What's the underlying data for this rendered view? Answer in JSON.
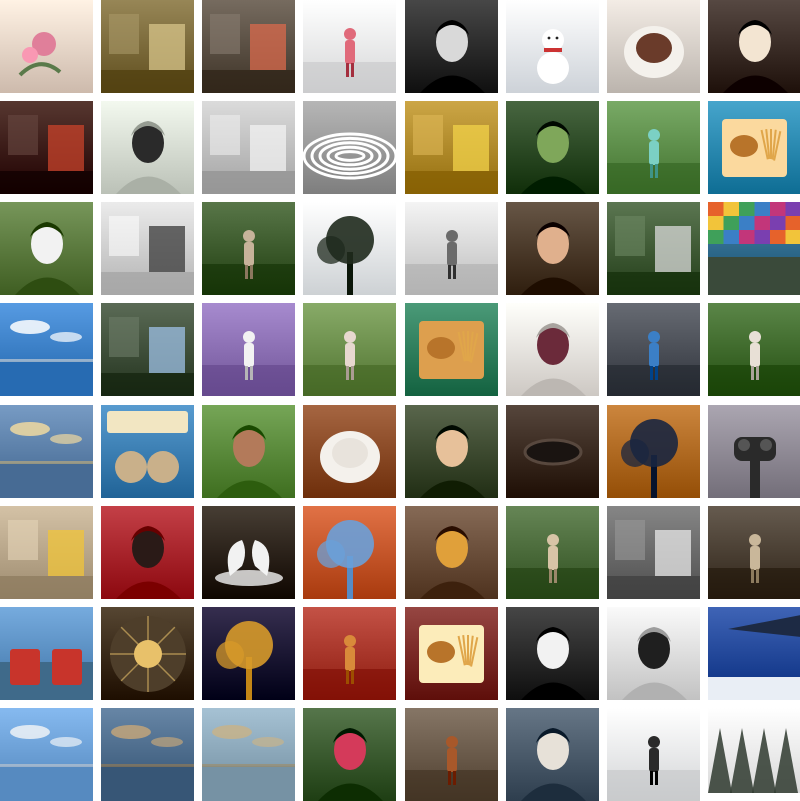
{
  "gallery": {
    "tiles": [
      {
        "icon": "pink-roses-photo",
        "bg": "#e9d6c8",
        "accent": "#e07f9a",
        "motif": "flower"
      },
      {
        "icon": "popcorn-stand-photo",
        "bg": "#7b6a3a",
        "accent": "#d7c48a",
        "motif": "scene"
      },
      {
        "icon": "cafe-counter-photo",
        "bg": "#5a4f43",
        "accent": "#d96a4c",
        "motif": "scene"
      },
      {
        "icon": "girl-in-snow-photo",
        "bg": "#f1f2f3",
        "accent": "#e06a7a",
        "motif": "figure"
      },
      {
        "icon": "smiling-woman-bw-photo",
        "bg": "#2b2b2b",
        "accent": "#d9d9d9",
        "motif": "portrait"
      },
      {
        "icon": "snowman-photo",
        "bg": "#e9eef4",
        "accent": "#ffffff",
        "motif": "snowman"
      },
      {
        "icon": "cocoa-cup-photo",
        "bg": "#d7d0c9",
        "accent": "#6a3b2a",
        "motif": "cup"
      },
      {
        "icon": "masked-face-photo",
        "bg": "#3a2c26",
        "accent": "#f3e5d2",
        "motif": "portrait"
      },
      {
        "icon": "theater-interior-photo",
        "bg": "#3b1b14",
        "accent": "#c8432b",
        "motif": "scene"
      },
      {
        "icon": "man-drinking-photo",
        "bg": "#d7ddd3",
        "accent": "#2a2a2a",
        "motif": "portrait"
      },
      {
        "icon": "man-in-bed-bw-photo",
        "bg": "#bfbfbf",
        "accent": "#f2f2f2",
        "motif": "scene"
      },
      {
        "icon": "guggenheim-rotunda-photo",
        "bg": "#9a9a9a",
        "accent": "#ffffff",
        "motif": "rings"
      },
      {
        "icon": "taxi-raindrops-photo",
        "bg": "#b08a2a",
        "accent": "#f2d14a",
        "motif": "scene"
      },
      {
        "icon": "woman-in-leaves-photo",
        "bg": "#2c4a25",
        "accent": "#7fa75a",
        "motif": "portrait"
      },
      {
        "icon": "man-with-bike-photo",
        "bg": "#5d8e4a",
        "accent": "#7bd0c4",
        "motif": "figure"
      },
      {
        "icon": "sandwich-and-fries-photo",
        "bg": "#2a89b0",
        "accent": "#e7c58a",
        "motif": "food"
      },
      {
        "icon": "man-sunglasses-photo",
        "bg": "#5b7a3e",
        "accent": "#f2f2f2",
        "motif": "portrait"
      },
      {
        "icon": "loft-interior-bw-photo",
        "bg": "#cfcfcf",
        "accent": "#3a3a3a",
        "motif": "scene"
      },
      {
        "icon": "woman-in-forest-photo",
        "bg": "#3c5a2c",
        "accent": "#c7b39a",
        "motif": "figure"
      },
      {
        "icon": "tree-silhouette-photo",
        "bg": "#e9edf0",
        "accent": "#1f2a1d",
        "motif": "tree"
      },
      {
        "icon": "gallery-wall-photo",
        "bg": "#d8d8d8",
        "accent": "#6b6b6b",
        "motif": "figure"
      },
      {
        "icon": "smiling-bearded-man-photo",
        "bg": "#4b3a2a",
        "accent": "#e0b08d",
        "motif": "portrait"
      },
      {
        "icon": "car-driving-photo",
        "bg": "#3f5a35",
        "accent": "#d9d9d9",
        "motif": "scene"
      },
      {
        "icon": "colorful-mural-photo",
        "bg": "#2f6a8c",
        "accent": "#e6622b",
        "motif": "mural"
      },
      {
        "icon": "lake-fountain-photo",
        "bg": "#3b7fc6",
        "accent": "#ffffff",
        "motif": "lake"
      },
      {
        "icon": "car-window-view-photo",
        "bg": "#3f4f3a",
        "accent": "#9dc0e6",
        "motif": "scene"
      },
      {
        "icon": "lavender-field-photo",
        "bg": "#8b6fb3",
        "accent": "#f2f2f2",
        "motif": "figure"
      },
      {
        "icon": "woman-in-park-photo",
        "bg": "#6c8f4c",
        "accent": "#e7d8cf",
        "motif": "figure"
      },
      {
        "icon": "burger-and-fries-photo",
        "bg": "#2f7e5c",
        "accent": "#c98b3a",
        "motif": "food"
      },
      {
        "icon": "eyes-with-figs-photo",
        "bg": "#e9e4df",
        "accent": "#6b2a3a",
        "motif": "portrait"
      },
      {
        "icon": "tandem-bicycle-photo",
        "bg": "#4b4f57",
        "accent": "#3b7fc6",
        "motif": "figure"
      },
      {
        "icon": "cow-in-field-photo",
        "bg": "#3f6a2c",
        "accent": "#e8e0d6",
        "motif": "figure"
      },
      {
        "icon": "beach-sunset-dancer-photo",
        "bg": "#5b7fa8",
        "accent": "#f0d9a0",
        "motif": "lake"
      },
      {
        "icon": "ben-and-jerrys-sign-photo",
        "bg": "#3c7fb3",
        "accent": "#f2e6c2",
        "motif": "sign"
      },
      {
        "icon": "smiling-woman-photo",
        "bg": "#5a8a3b",
        "accent": "#b37a5a",
        "motif": "portrait"
      },
      {
        "icon": "coffee-and-donut-photo",
        "bg": "#8a4a26",
        "accent": "#e8e3dc",
        "motif": "cup"
      },
      {
        "icon": "man-with-camera-photo",
        "bg": "#3d4a30",
        "accent": "#e7c19a",
        "motif": "portrait"
      },
      {
        "icon": "horse-eye-photo",
        "bg": "#3a2a20",
        "accent": "#1a1411",
        "motif": "eye"
      },
      {
        "icon": "autumn-trees-man-photo",
        "bg": "#b06a22",
        "accent": "#1a2640",
        "motif": "tree"
      },
      {
        "icon": "binocular-viewer-photo",
        "bg": "#8f8a95",
        "accent": "#2a2a2a",
        "motif": "viewer"
      },
      {
        "icon": "yellow-umbrella-photo",
        "bg": "#b8a68a",
        "accent": "#f0c43a",
        "motif": "scene"
      },
      {
        "icon": "woman-red-flowers-photo",
        "bg": "#a8242b",
        "accent": "#2a1a17",
        "motif": "portrait"
      },
      {
        "icon": "swans-heart-photo",
        "bg": "#2b2218",
        "accent": "#f2f2f2",
        "motif": "swans"
      },
      {
        "icon": "autumn-tree-statue-photo",
        "bg": "#c5562a",
        "accent": "#6aa0d9",
        "motif": "tree"
      },
      {
        "icon": "man-drinking-coffee-photo",
        "bg": "#6a4e3a",
        "accent": "#e0a03a",
        "motif": "portrait"
      },
      {
        "icon": "couple-under-tree-photo",
        "bg": "#4a6a3a",
        "accent": "#d7c4a6",
        "motif": "figure"
      },
      {
        "icon": "couple-restaurant-bw-photo",
        "bg": "#6a6a6a",
        "accent": "#e8e8e8",
        "motif": "scene"
      },
      {
        "icon": "cobblestone-street-photo",
        "bg": "#4a3f33",
        "accent": "#c9b79a",
        "motif": "figure"
      },
      {
        "icon": "red-adirondack-chairs-photo",
        "bg": "#5a8fc2",
        "accent": "#c8342b",
        "motif": "chairs"
      },
      {
        "icon": "domed-ceiling-photo",
        "bg": "#3a2a16",
        "accent": "#e8c16a",
        "motif": "dome"
      },
      {
        "icon": "night-trees-photo",
        "bg": "#1a1233",
        "accent": "#d79a2a",
        "motif": "tree"
      },
      {
        "icon": "autumn-silhouette-photo",
        "bg": "#a8362a",
        "accent": "#d98a3a",
        "motif": "figure"
      },
      {
        "icon": "brunch-table-photo",
        "bg": "#7a2a26",
        "accent": "#e8d8a6",
        "motif": "food"
      },
      {
        "icon": "sparkler-man-bw-photo",
        "bg": "#2a2a2a",
        "accent": "#f2f2f2",
        "motif": "portrait"
      },
      {
        "icon": "woman-cityscape-wall-photo",
        "bg": "#dedede",
        "accent": "#1f1f1f",
        "motif": "portrait"
      },
      {
        "icon": "airplane-wing-photo",
        "bg": "#23489a",
        "accent": "#e9eef5",
        "motif": "wing"
      },
      {
        "icon": "cloudy-sky-photo",
        "bg": "#6a9ed4",
        "accent": "#eef2f6",
        "motif": "lake"
      },
      {
        "icon": "bridge-coast-photo",
        "bg": "#4b6a8a",
        "accent": "#c2a57a",
        "motif": "lake"
      },
      {
        "icon": "beach-driftwood-photo",
        "bg": "#8aa6b8",
        "accent": "#c7b38a",
        "motif": "lake"
      },
      {
        "icon": "pink-hat-woman-photo",
        "bg": "#3a5a2f",
        "accent": "#d43a5a",
        "motif": "portrait"
      },
      {
        "icon": "horse-carriage-photo",
        "bg": "#6a5a4a",
        "accent": "#a8582a",
        "motif": "figure"
      },
      {
        "icon": "woman-fur-hood-photo",
        "bg": "#4a5a6a",
        "accent": "#e7e1d8",
        "motif": "portrait"
      },
      {
        "icon": "snowy-park-figure-photo",
        "bg": "#eef0f2",
        "accent": "#2a2a2a",
        "motif": "figure"
      },
      {
        "icon": "snowy-pines-photo",
        "bg": "#f2f2f2",
        "accent": "#2f3a2f",
        "motif": "pines"
      }
    ]
  }
}
